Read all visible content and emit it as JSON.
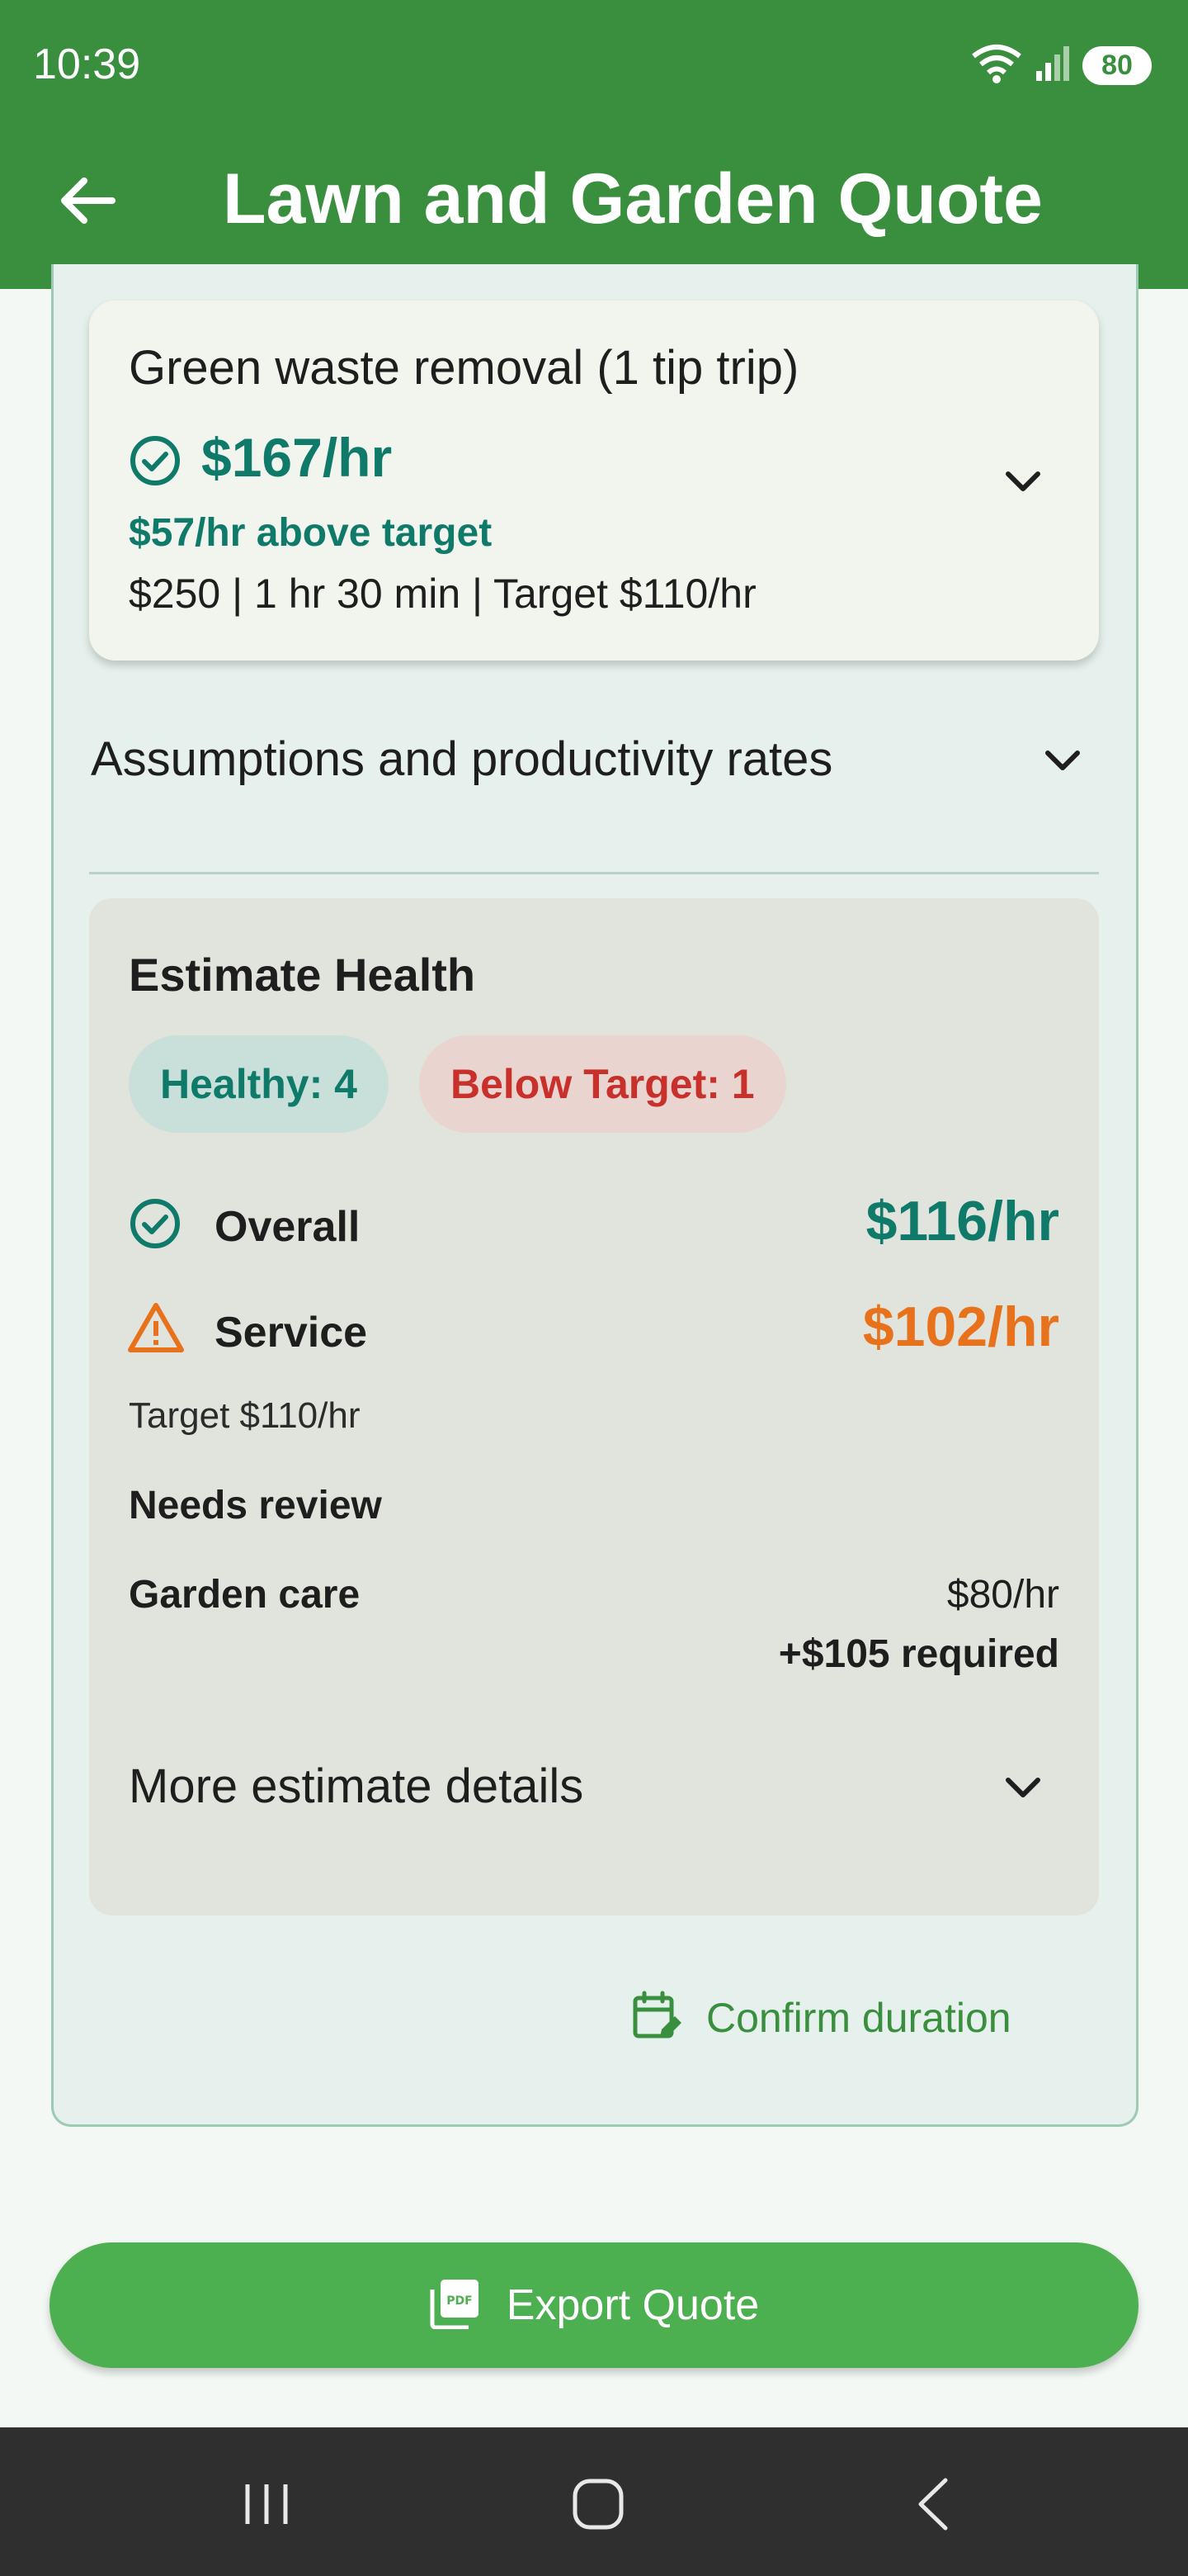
{
  "status_bar": {
    "time": "10:39",
    "battery": "80",
    "icons": [
      "wifi-icon",
      "signal-icon",
      "battery-icon"
    ]
  },
  "app_bar": {
    "title": "Lawn and Garden Quote",
    "back_icon": "arrow-left-icon"
  },
  "line_item": {
    "title": "Green waste removal (1 tip trip)",
    "rate": "$167/hr",
    "diff": "$57/hr above target",
    "summary": "$250 | 1 hr 30 min | Target $110/hr",
    "status_icon": "check-circle-icon",
    "expand_icon": "chevron-down-icon"
  },
  "assumptions": {
    "label": "Assumptions and productivity rates"
  },
  "health": {
    "title": "Estimate Health",
    "chip_healthy": "Healthy: 4",
    "chip_below": "Below Target: 1",
    "overall_label": "Overall",
    "overall_rate": "$116/hr",
    "service_label": "Service",
    "service_rate": "$102/hr",
    "target_note": "Target $110/hr",
    "needs_review": "Needs review",
    "review_item_label": "Garden care",
    "review_item_rate": "$80/hr",
    "review_item_required": "+$105 required",
    "more_details": "More estimate details"
  },
  "confirm": {
    "label": "Confirm duration",
    "icon": "calendar-edit-icon"
  },
  "export": {
    "label": "Export Quote",
    "icon": "pdf-icon"
  },
  "colors": {
    "brand_green": "#3a8f3f",
    "button_green": "#4caf50",
    "healthy_teal": "#0f7a6a",
    "warning_orange": "#e8711c",
    "danger_red": "#c8302c"
  }
}
